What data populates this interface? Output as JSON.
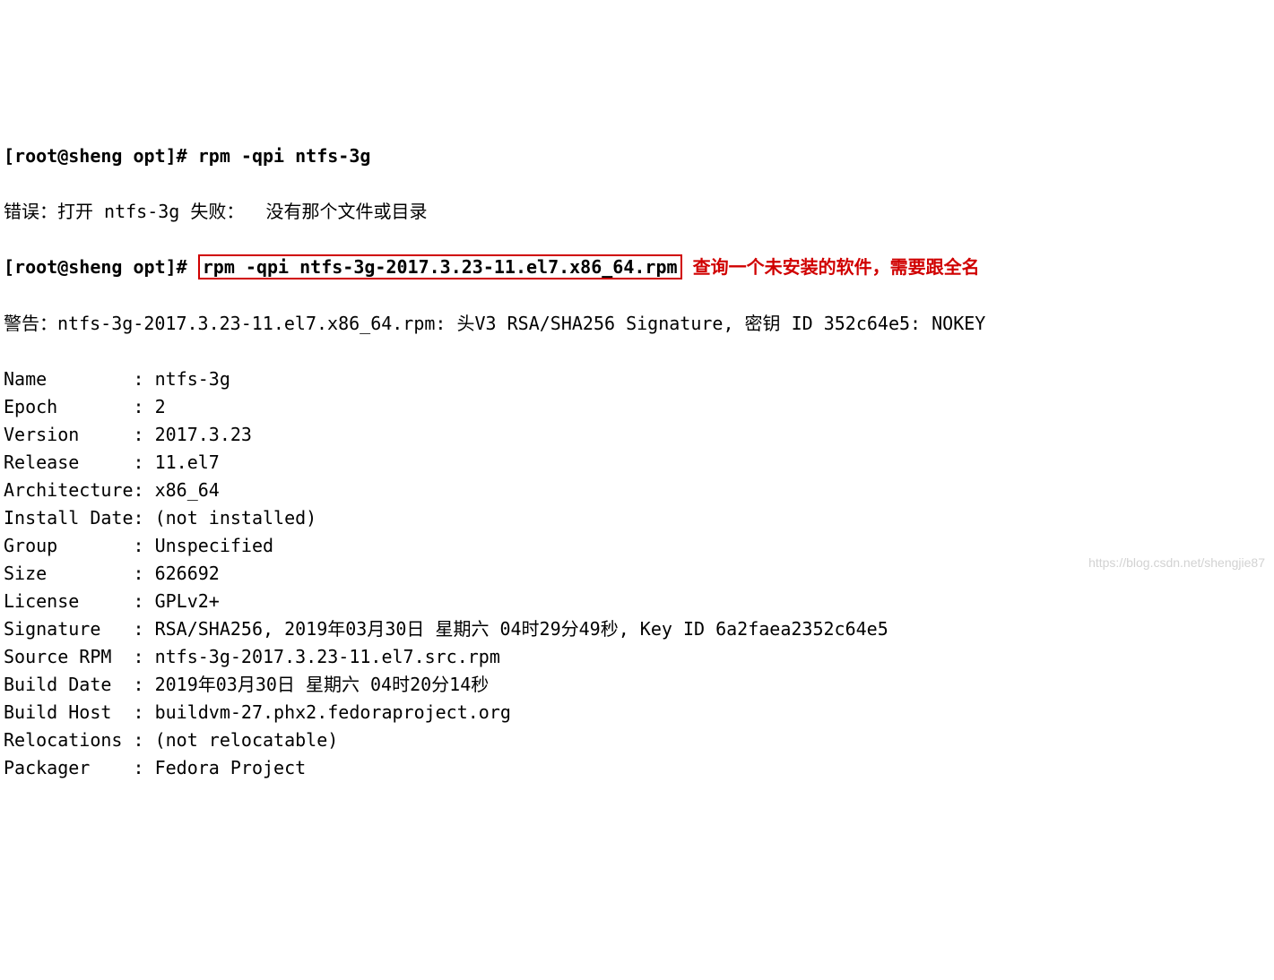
{
  "line1": {
    "prompt": "[root@sheng opt]#",
    "cmd": "rpm -qpi ntfs-3g"
  },
  "line2": "错误：打开 ntfs-3g 失败：  没有那个文件或目录",
  "line3": {
    "prompt": "[root@sheng opt]#",
    "cmd": "rpm -qpi ntfs-3g-2017.3.23-11.el7.x86_64.rpm",
    "annotation": "查询一个未安装的软件，需要跟全名"
  },
  "line4": "警告：ntfs-3g-2017.3.23-11.el7.x86_64.rpm: 头V3 RSA/SHA256 Signature, 密钥 ID 352c64e5: NOKEY",
  "fields": [
    {
      "label": "Name",
      "value": "ntfs-3g"
    },
    {
      "label": "Epoch",
      "value": "2"
    },
    {
      "label": "Version",
      "value": "2017.3.23"
    },
    {
      "label": "Release",
      "value": "11.el7"
    },
    {
      "label": "Architecture",
      "value": "x86_64"
    },
    {
      "label": "Install Date",
      "value": "(not installed)"
    },
    {
      "label": "Group",
      "value": "Unspecified"
    },
    {
      "label": "Size",
      "value": "626692"
    },
    {
      "label": "License",
      "value": "GPLv2+"
    },
    {
      "label": "Signature",
      "value": "RSA/SHA256, 2019年03月30日 星期六 04时29分49秒, Key ID 6a2faea2352c64e5"
    },
    {
      "label": "Source RPM",
      "value": "ntfs-3g-2017.3.23-11.el7.src.rpm"
    },
    {
      "label": "Build Date",
      "value": "2019年03月30日 星期六 04时20分14秒"
    },
    {
      "label": "Build Host",
      "value": "buildvm-27.phx2.fedoraproject.org"
    },
    {
      "label": "Relocations",
      "value": "(not relocatable)"
    },
    {
      "label": "Packager",
      "value": "Fedora Project"
    }
  ],
  "watermark": "https://blog.csdn.net/shengjie87"
}
